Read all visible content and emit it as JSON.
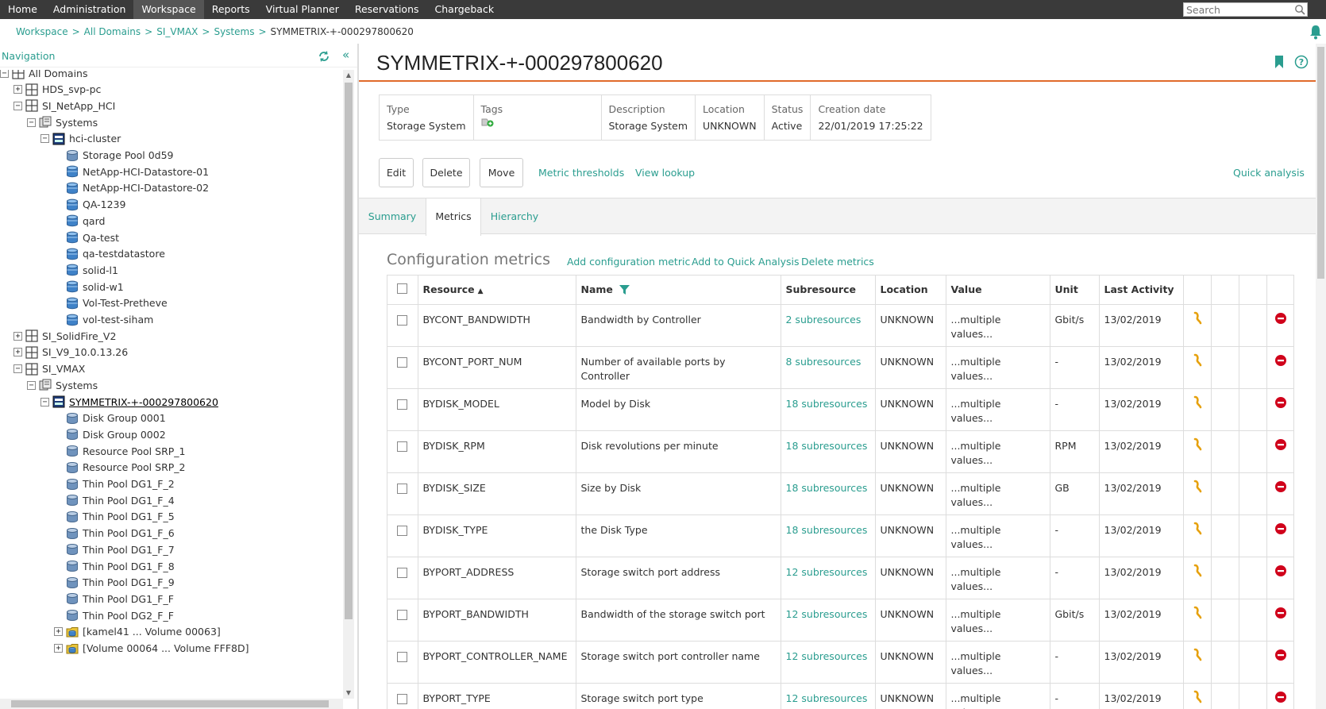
{
  "top_menu": {
    "items": [
      "Home",
      "Administration",
      "Workspace",
      "Reports",
      "Virtual Planner",
      "Reservations",
      "Chargeback"
    ],
    "active": "Workspace",
    "search_placeholder": "Search"
  },
  "breadcrumb": [
    "Workspace",
    "All Domains",
    "SI_VMAX",
    "Systems",
    "SYMMETRIX-+-000297800620"
  ],
  "navigation": {
    "title": "Navigation",
    "tree": [
      {
        "label": "All Domains",
        "level": 0,
        "toggle": "-",
        "icon": "domain-icon"
      },
      {
        "label": "HDS_svp-pc",
        "level": 1,
        "toggle": "+",
        "icon": "domain-icon"
      },
      {
        "label": "SI_NetApp_HCI",
        "level": 1,
        "toggle": "-",
        "icon": "domain-icon"
      },
      {
        "label": "Systems",
        "level": 2,
        "toggle": "-",
        "icon": "systems-folder-icon"
      },
      {
        "label": "hci-cluster",
        "level": 3,
        "toggle": "-",
        "icon": "storage-system-icon"
      },
      {
        "label": "Storage Pool 0d59",
        "level": 4,
        "toggle": "",
        "icon": "storage-pool-icon"
      },
      {
        "label": "NetApp-HCI-Datastore-01",
        "level": 4,
        "toggle": "",
        "icon": "volume-icon"
      },
      {
        "label": "NetApp-HCI-Datastore-02",
        "level": 4,
        "toggle": "",
        "icon": "volume-icon"
      },
      {
        "label": "QA-1239",
        "level": 4,
        "toggle": "",
        "icon": "volume-icon"
      },
      {
        "label": "qard",
        "level": 4,
        "toggle": "",
        "icon": "volume-icon"
      },
      {
        "label": "Qa-test",
        "level": 4,
        "toggle": "",
        "icon": "volume-icon"
      },
      {
        "label": "qa-testdatastore",
        "level": 4,
        "toggle": "",
        "icon": "volume-icon"
      },
      {
        "label": "solid-l1",
        "level": 4,
        "toggle": "",
        "icon": "volume-icon"
      },
      {
        "label": "solid-w1",
        "level": 4,
        "toggle": "",
        "icon": "volume-icon"
      },
      {
        "label": "Vol-Test-Pretheve",
        "level": 4,
        "toggle": "",
        "icon": "volume-icon"
      },
      {
        "label": "vol-test-siham",
        "level": 4,
        "toggle": "",
        "icon": "volume-icon"
      },
      {
        "label": "SI_SolidFire_V2",
        "level": 1,
        "toggle": "+",
        "icon": "domain-icon"
      },
      {
        "label": "SI_V9_10.0.13.26",
        "level": 1,
        "toggle": "+",
        "icon": "domain-icon"
      },
      {
        "label": "SI_VMAX",
        "level": 1,
        "toggle": "-",
        "icon": "domain-icon"
      },
      {
        "label": "Systems",
        "level": 2,
        "toggle": "-",
        "icon": "systems-folder-icon"
      },
      {
        "label": "SYMMETRIX-+-000297800620",
        "level": 3,
        "toggle": "-",
        "icon": "storage-system-icon",
        "selected": true
      },
      {
        "label": "Disk Group 0001",
        "level": 4,
        "toggle": "",
        "icon": "storage-pool-icon"
      },
      {
        "label": "Disk Group 0002",
        "level": 4,
        "toggle": "",
        "icon": "storage-pool-icon"
      },
      {
        "label": "Resource Pool SRP_1",
        "level": 4,
        "toggle": "",
        "icon": "storage-pool-icon"
      },
      {
        "label": "Resource Pool SRP_2",
        "level": 4,
        "toggle": "",
        "icon": "storage-pool-icon"
      },
      {
        "label": "Thin Pool DG1_F_2",
        "level": 4,
        "toggle": "",
        "icon": "storage-pool-icon"
      },
      {
        "label": "Thin Pool DG1_F_4",
        "level": 4,
        "toggle": "",
        "icon": "storage-pool-icon"
      },
      {
        "label": "Thin Pool DG1_F_5",
        "level": 4,
        "toggle": "",
        "icon": "storage-pool-icon"
      },
      {
        "label": "Thin Pool DG1_F_6",
        "level": 4,
        "toggle": "",
        "icon": "storage-pool-icon"
      },
      {
        "label": "Thin Pool DG1_F_7",
        "level": 4,
        "toggle": "",
        "icon": "storage-pool-icon"
      },
      {
        "label": "Thin Pool DG1_F_8",
        "level": 4,
        "toggle": "",
        "icon": "storage-pool-icon"
      },
      {
        "label": "Thin Pool DG1_F_9",
        "level": 4,
        "toggle": "",
        "icon": "storage-pool-icon"
      },
      {
        "label": "Thin Pool DG1_F_F",
        "level": 4,
        "toggle": "",
        "icon": "storage-pool-icon"
      },
      {
        "label": "Thin Pool DG2_F_F",
        "level": 4,
        "toggle": "",
        "icon": "storage-pool-icon"
      },
      {
        "label": "[kamel41 ... Volume 00063]",
        "level": 4,
        "toggle": "+",
        "icon": "volume-group-icon"
      },
      {
        "label": "[Volume 00064 ... Volume FFF8D]",
        "level": 4,
        "toggle": "+",
        "icon": "volume-group-icon"
      }
    ]
  },
  "system": {
    "title": "SYMMETRIX-+-000297800620",
    "properties": [
      {
        "label": "Type",
        "value": "Storage System"
      },
      {
        "label": "Tags",
        "value": ""
      },
      {
        "label": "Description",
        "value": "Storage System"
      },
      {
        "label": "Location",
        "value": "UNKNOWN"
      },
      {
        "label": "Status",
        "value": "Active"
      },
      {
        "label": "Creation date",
        "value": "22/01/2019 17:25:22"
      }
    ]
  },
  "actions": {
    "edit": "Edit",
    "delete": "Delete",
    "move": "Move",
    "metric_thresholds": "Metric thresholds",
    "view_lookup": "View lookup",
    "quick_analysis": "Quick analysis"
  },
  "tabs": [
    "Summary",
    "Metrics",
    "Hierarchy"
  ],
  "active_tab": "Metrics",
  "metrics": {
    "title": "Configuration metrics",
    "add_metric": "Add configuration metric",
    "add_quick": "Add to Quick Analysis",
    "delete_metrics": "Delete metrics",
    "columns": [
      "Resource",
      "Name",
      "Subresource",
      "Location",
      "Value",
      "Unit",
      "Last Activity"
    ],
    "rows": [
      {
        "resource": "BYCONT_BANDWIDTH",
        "name": "Bandwidth by Controller",
        "subresource": "2 subresources",
        "location": "UNKNOWN",
        "value": "...multiple values...",
        "unit": "Gbit/s",
        "last": "13/02/2019"
      },
      {
        "resource": "BYCONT_PORT_NUM",
        "name": "Number of available ports by Controller",
        "subresource": "8 subresources",
        "location": "UNKNOWN",
        "value": "...multiple values...",
        "unit": "-",
        "last": "13/02/2019"
      },
      {
        "resource": "BYDISK_MODEL",
        "name": "Model by Disk",
        "subresource": "18 subresources",
        "location": "UNKNOWN",
        "value": "...multiple values...",
        "unit": "-",
        "last": "13/02/2019"
      },
      {
        "resource": "BYDISK_RPM",
        "name": "Disk revolutions per minute",
        "subresource": "18 subresources",
        "location": "UNKNOWN",
        "value": "...multiple values...",
        "unit": "RPM",
        "last": "13/02/2019"
      },
      {
        "resource": "BYDISK_SIZE",
        "name": "Size by Disk",
        "subresource": "18 subresources",
        "location": "UNKNOWN",
        "value": "...multiple values...",
        "unit": "GB",
        "last": "13/02/2019"
      },
      {
        "resource": "BYDISK_TYPE",
        "name": "the Disk Type",
        "subresource": "18 subresources",
        "location": "UNKNOWN",
        "value": "...multiple values...",
        "unit": "-",
        "last": "13/02/2019"
      },
      {
        "resource": "BYPORT_ADDRESS",
        "name": "Storage switch port address",
        "subresource": "12 subresources",
        "location": "UNKNOWN",
        "value": "...multiple values...",
        "unit": "-",
        "last": "13/02/2019"
      },
      {
        "resource": "BYPORT_BANDWIDTH",
        "name": "Bandwidth of the storage switch port",
        "subresource": "12 subresources",
        "location": "UNKNOWN",
        "value": "...multiple values...",
        "unit": "Gbit/s",
        "last": "13/02/2019"
      },
      {
        "resource": "BYPORT_CONTROLLER_NAME",
        "name": "Storage switch port controller name",
        "subresource": "12 subresources",
        "location": "UNKNOWN",
        "value": "...multiple values...",
        "unit": "-",
        "last": "13/02/2019"
      },
      {
        "resource": "BYPORT_TYPE",
        "name": "Storage switch port type",
        "subresource": "12 subresources",
        "location": "UNKNOWN",
        "value": "...multiple values...",
        "unit": "-",
        "last": "13/02/2019"
      }
    ]
  },
  "colors": {
    "accent": "#2a9d8f",
    "title_rule": "#e06a2a",
    "delete_red": "#d0021b",
    "topbar": "#3a3a3a"
  }
}
